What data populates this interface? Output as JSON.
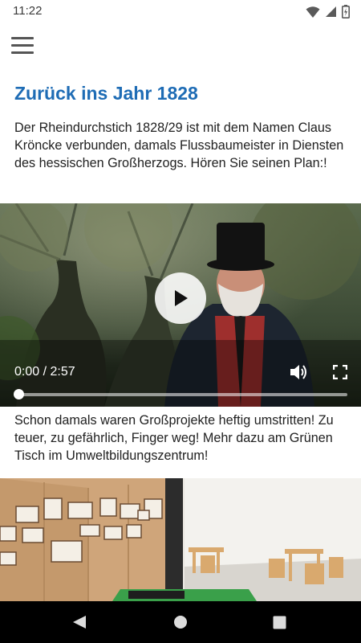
{
  "status_bar": {
    "time": "11:22",
    "icons": [
      "wifi-icon",
      "cell-signal-icon",
      "battery-icon"
    ]
  },
  "header": {
    "menu_icon": "hamburger-menu-icon"
  },
  "article": {
    "title": "Zurück ins Jahr 1828",
    "intro": "Der Rheindurchstich 1828/29 ist mit dem Namen Claus Kröncke verbunden, damals Flussbaumeister in Diensten des hessischen Großherzogs. Hören Sie seinen Plan:!",
    "second_paragraph": "Schon damals waren Großprojekte heftig umstritten! Zu teuer, zu gefährlich, Finger weg! Mehr dazu am Grünen Tisch im Umweltbildungszentrum!"
  },
  "video_player": {
    "current_time": "0:00",
    "duration": "2:57",
    "time_display": "0:00 / 2:57",
    "progress_fraction": 0,
    "controls": [
      "play-icon",
      "volume-icon",
      "fullscreen-icon"
    ]
  },
  "nav_bar": {
    "buttons": [
      "back-icon",
      "home-icon",
      "recents-icon"
    ]
  },
  "colors": {
    "title": "#1e6cb5",
    "text": "#212121",
    "nav_bar": "#000000"
  }
}
